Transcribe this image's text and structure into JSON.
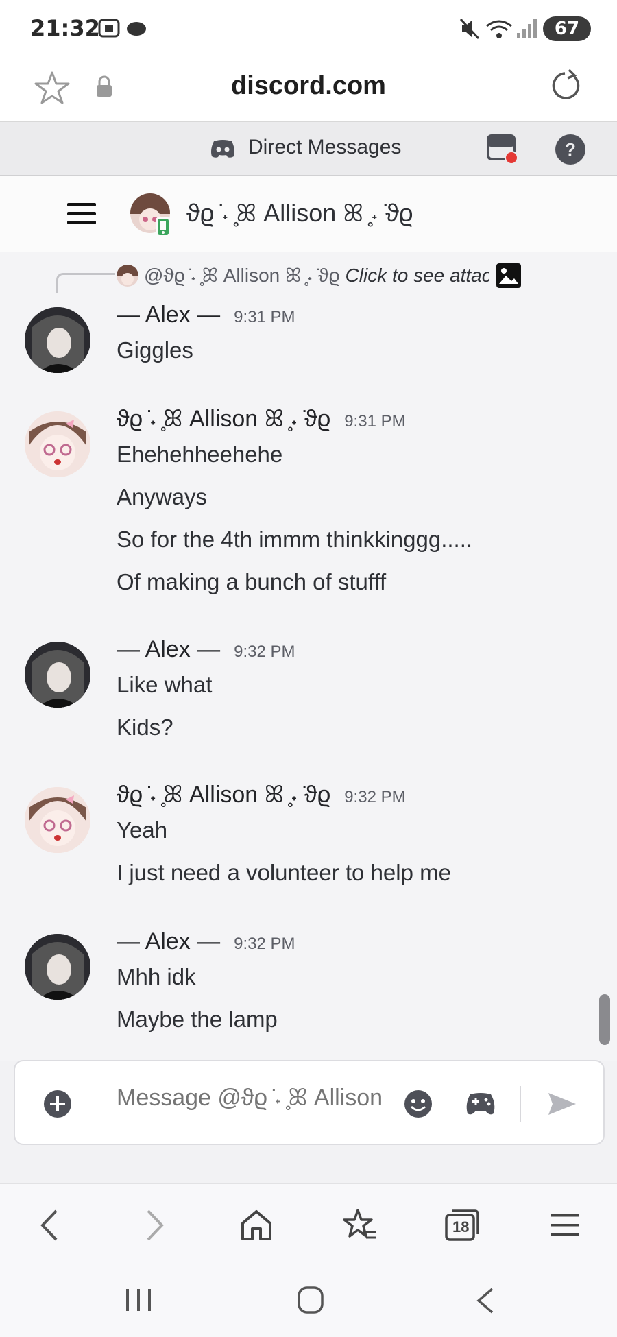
{
  "status_bar": {
    "time": "21:32",
    "battery": "67"
  },
  "browser": {
    "url": "discord.com",
    "tabs_count": "18"
  },
  "discord": {
    "section_title": "Direct Messages",
    "channel_name": "ϑϱ ̇˖ ̥ꕤ Allison ꕤ ̥˖ ̇ϑϱ"
  },
  "reply_preview": {
    "mention": "@ϑϱ ̇˖ ̥ꕤ Allison ꕤ ̥˖ ̇ϑϱ",
    "text": "Click to see attachment"
  },
  "messages": [
    {
      "author": "— Alex —",
      "time": "9:31 PM",
      "lines": [
        "Giggles"
      ]
    },
    {
      "author": "ϑϱ ̇˖ ̥ꕤ Allison ꕤ ̥˖ ̇ϑϱ",
      "time": "9:31 PM",
      "lines": [
        "Ehehehheehehe",
        "Anyways",
        "So for the 4th immm thinkkinggg.....",
        "Of making a bunch of stufff"
      ]
    },
    {
      "author": "— Alex —",
      "time": "9:32 PM",
      "lines": [
        "Like what",
        "Kids?"
      ]
    },
    {
      "author": "ϑϱ ̇˖ ̥ꕤ Allison ꕤ ̥˖ ̇ϑϱ",
      "time": "9:32 PM",
      "lines": [
        "Yeah",
        "I just need a volunteer to help me"
      ]
    },
    {
      "author": "— Alex —",
      "time": "9:32 PM",
      "lines": [
        "Mhh idk",
        "Maybe the lamp"
      ]
    }
  ],
  "composer": {
    "placeholder": "Message @ϑϱ ̇˖ ̥ꕤ Allison"
  },
  "colors": {
    "discord_blurple": "#5865f2",
    "status_red": "#e53935",
    "mobile_green": "#3ba55c"
  }
}
